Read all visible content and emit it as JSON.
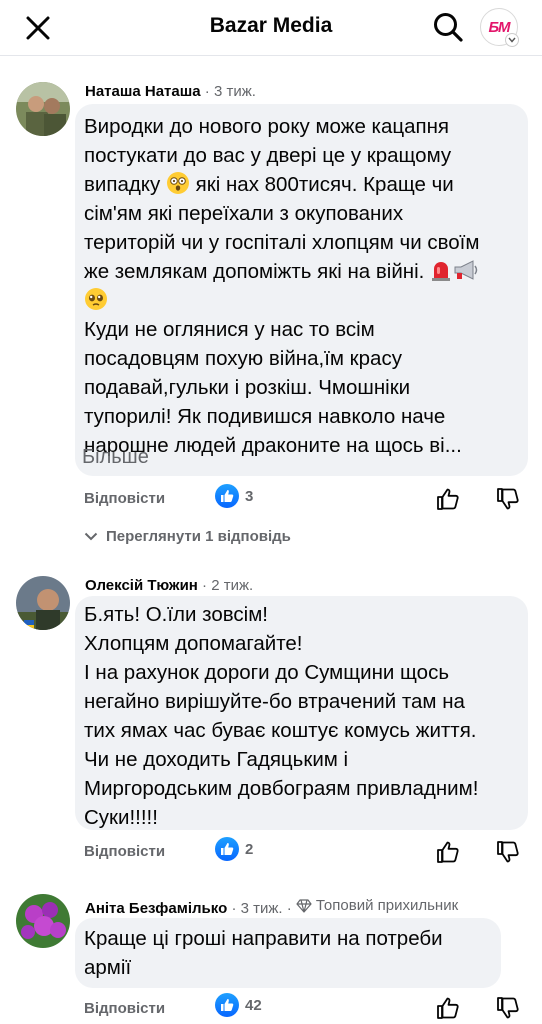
{
  "header": {
    "title": "Bazar Media",
    "logo_text": "БМ",
    "close_icon": "close-icon",
    "search_icon": "search-icon"
  },
  "comments": [
    {
      "author": "Наташа Наташа",
      "time": "3 тиж.",
      "lines": [
        "Виродки до нового року може кацапня",
        "постукати до вас у двері це у кращому",
        "випадку",
        " які нах 800тисяч. Краще чи",
        "сім'ям які переїхали з окупованих",
        "територій чи у госпіталі хлопцям чи своїм",
        "же землякам допоміжть які на війні.",
        "Куди не оглянися у нас то всім",
        "посадовцям похую війна,їм красу",
        "подавай,гульки і розкіш. Чмошніки",
        "тупорилі! Як подивишся навколо наче",
        "нарошне людей драконите на щось ві..."
      ],
      "more_label": "Більше",
      "reply_label": "Відповісти",
      "like_count": "3",
      "view_replies_label": "Переглянути 1 відповідь"
    },
    {
      "author": "Олексій Тюжин",
      "time": "2 тиж.",
      "lines": [
        "Б.ять! О.їли зовсім!",
        "Хлопцям допомагайте!",
        "І на рахунок дороги до Сумщини щось",
        "негайно вирішуйте-бо втрачений там на",
        "тих ямах час буває коштує комусь життя.",
        "Чи не доходить Гадяцьким і",
        "Миргородським довбограям привладним!",
        "Суки!!!!!"
      ],
      "reply_label": "Відповісти",
      "like_count": "2"
    },
    {
      "author": "Аніта Безфамілько",
      "time": "3 тиж.",
      "badge": "Топовий прихильник",
      "lines": [
        "Краще ці гроші направити на потреби",
        "армії"
      ],
      "reply_label": "Відповісти",
      "like_count": "42"
    }
  ],
  "colors": {
    "like_blue": "#0866ff",
    "bubble_bg": "#f0f2f5",
    "secondary_text": "#65676b",
    "logo_pink": "#e3166b"
  }
}
